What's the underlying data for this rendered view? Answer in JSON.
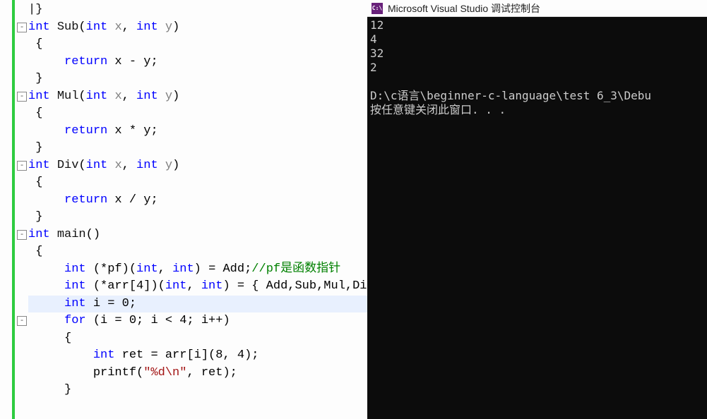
{
  "editor": {
    "lines": [
      {
        "html": "<span class='brace'>|}</span>",
        "fold": null
      },
      {
        "html": "<span class='kw'>int</span> <span class='func'>Sub</span>(<span class='kw'>int</span> <span class='param'>x</span>, <span class='kw'>int</span> <span class='param'>y</span>)",
        "fold": "-"
      },
      {
        "html": " {",
        "fold": null
      },
      {
        "html": "     <span class='kw'>return</span> x - y;",
        "fold": null
      },
      {
        "html": " }",
        "fold": null
      },
      {
        "html": "<span class='kw'>int</span> <span class='func'>Mul</span>(<span class='kw'>int</span> <span class='param'>x</span>, <span class='kw'>int</span> <span class='param'>y</span>)",
        "fold": "-"
      },
      {
        "html": " {",
        "fold": null
      },
      {
        "html": "     <span class='kw'>return</span> x * y;",
        "fold": null
      },
      {
        "html": " }",
        "fold": null
      },
      {
        "html": "<span class='kw'>int</span> <span class='func'>Div</span>(<span class='kw'>int</span> <span class='param'>x</span>, <span class='kw'>int</span> <span class='param'>y</span>)",
        "fold": "-"
      },
      {
        "html": " {",
        "fold": null
      },
      {
        "html": "     <span class='kw'>return</span> x / y;",
        "fold": null
      },
      {
        "html": " }",
        "fold": null
      },
      {
        "html": "<span class='kw'>int</span> <span class='func'>main</span>()",
        "fold": "-"
      },
      {
        "html": " {",
        "fold": null
      },
      {
        "html": "     <span class='kw'>int</span> (*pf)(<span class='kw'>int</span>, <span class='kw'>int</span>) = Add;<span class='comment'>//pf是函数指针</span>",
        "fold": null
      },
      {
        "html": "     <span class='kw'>int</span> (*arr[4])(<span class='kw'>int</span>, <span class='kw'>int</span>) = { Add,Sub,Mul,Di",
        "fold": null
      },
      {
        "html": "     <span class='kw'>int</span> i = 0;",
        "fold": null,
        "highlight": true
      },
      {
        "html": "     <span class='kw'>for</span> (i = 0; i &lt; 4; i++)",
        "fold": "-"
      },
      {
        "html": "     {",
        "fold": null
      },
      {
        "html": "         <span class='kw'>int</span> ret = arr[i](8, 4);",
        "fold": null
      },
      {
        "html": "         printf(<span class='str'>\"%d\\n\"</span>, ret);",
        "fold": null
      },
      {
        "html": "     }",
        "fold": null
      }
    ]
  },
  "console": {
    "icon_text": "C:\\",
    "title": "Microsoft Visual Studio 调试控制台",
    "output": "12\n4\n32\n2\n\nD:\\c语言\\beginner-c-language\\test 6_3\\Debu\n按任意键关闭此窗口. . ."
  }
}
